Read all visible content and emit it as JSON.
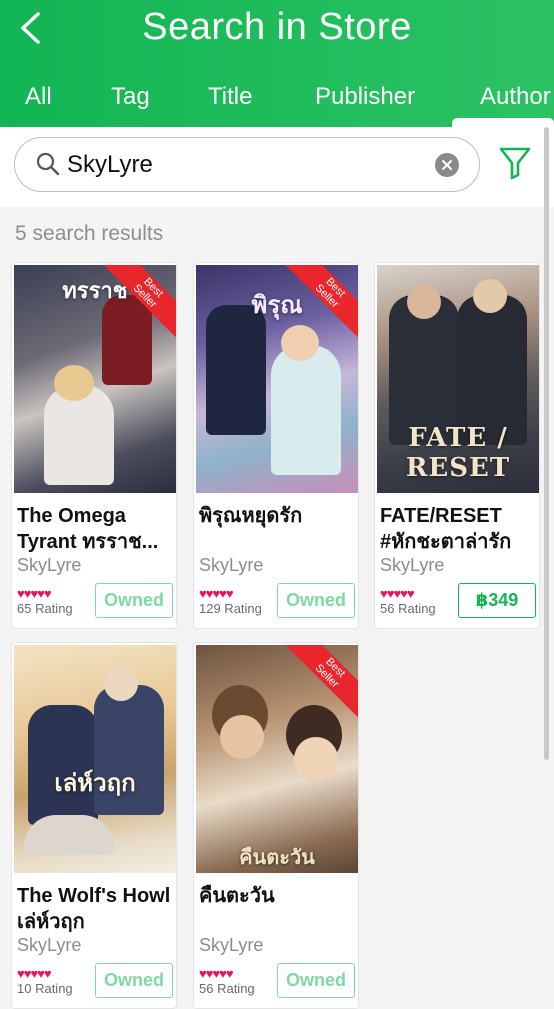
{
  "header": {
    "title": "Search in Store",
    "tabs": [
      "All",
      "Tag",
      "Title",
      "Publisher",
      "Author"
    ],
    "active_tab": "Author"
  },
  "search": {
    "value": "SkyLyre"
  },
  "results": {
    "count_label": "5 search results"
  },
  "books": [
    {
      "title": "The Omega Tyrant ทรราช...",
      "author": "SkyLyre",
      "rating_label": "65 Rating",
      "badge": "Best Seller",
      "action": "Owned",
      "cover_text": "ทรราช"
    },
    {
      "title": "พิรุณหยุดรัก",
      "author": "SkyLyre",
      "rating_label": "129 Rating",
      "badge": "Best Seller",
      "action": "Owned",
      "cover_text": "พิรุณ"
    },
    {
      "title": "FATE/RESET #หักชะตาล่ารัก",
      "author": "SkyLyre",
      "rating_label": "56 Rating",
      "badge": "",
      "action": "฿349",
      "cover_text": "FATE / RESET"
    },
    {
      "title": "The Wolf's Howl เล่ห์วฤก",
      "author": "SkyLyre",
      "rating_label": "10 Rating",
      "badge": "",
      "action": "Owned",
      "cover_text": "เล่ห์วฤก"
    },
    {
      "title": "คืนตะวัน",
      "author": "SkyLyre",
      "rating_label": "56 Rating",
      "badge": "Best Seller",
      "action": "Owned",
      "cover_text": "คืนตะวัน"
    }
  ],
  "hearts": "♥♥♥♥♥",
  "colors": {
    "brand_green": "#12b553",
    "owned_green": "#7ed9a4",
    "heart_pink": "#e4145f",
    "ribbon_red": "#e8262b"
  }
}
